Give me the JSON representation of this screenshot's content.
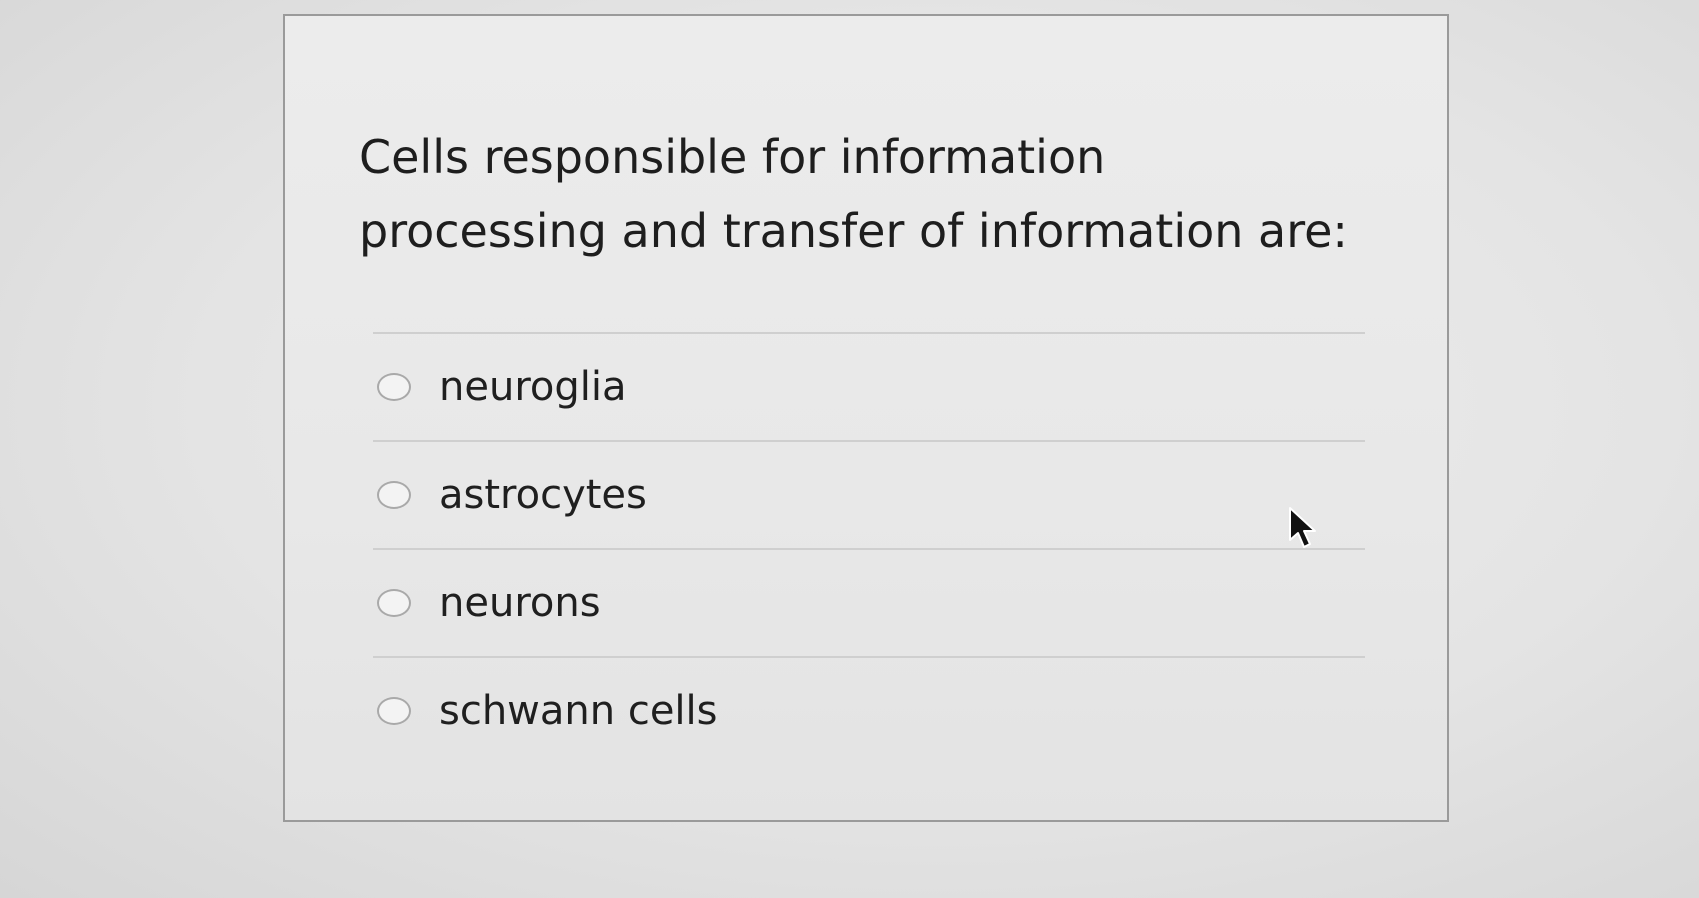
{
  "question": {
    "text": "Cells responsible for information processing and transfer of information are:"
  },
  "options": [
    {
      "label": "neuroglia"
    },
    {
      "label": "astrocytes"
    },
    {
      "label": "neurons"
    },
    {
      "label": "schwann cells"
    }
  ],
  "icons": {
    "radio": "radio-circle-icon",
    "cursor": "mouse-pointer-icon"
  }
}
